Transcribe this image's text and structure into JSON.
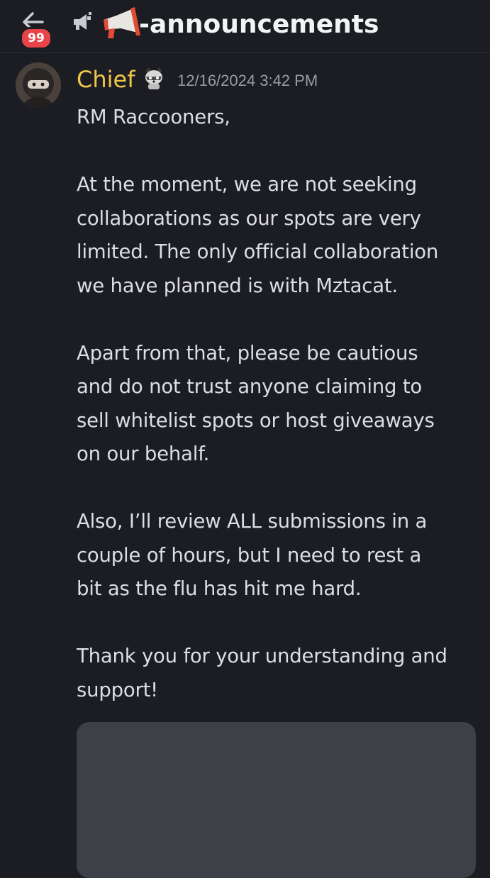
{
  "header": {
    "back_icon": "arrow-left-icon",
    "unread_badge": "99",
    "channel_type_icon": "announcement-channel-icon",
    "channel_emoji": "📣",
    "channel_name": "-announcements"
  },
  "message": {
    "author": "Chief",
    "role_icon": "raccoon-icon",
    "timestamp": "12/16/2024 3:42 PM",
    "paragraphs": [
      [
        "RM Raccooners,"
      ],
      [
        "At the moment, we are not seeking",
        "collaborations as our spots are very",
        "limited. The only official collaboration",
        "we have planned is with Mztacat."
      ],
      [
        "Apart from that, please be cautious",
        "and do not trust anyone claiming to",
        "sell whitelist spots or host giveaways",
        "on our behalf."
      ],
      [
        "Also, I’ll review ALL submissions in a",
        "couple of hours, but I need to rest a",
        "bit as the flu has hit me hard."
      ],
      [
        "Thank you for your understanding and",
        "support!"
      ]
    ]
  },
  "colors": {
    "background": "#1c1d22",
    "author": "#f0c64a",
    "badge": "#e9434a",
    "text": "#dcdee3",
    "timestamp": "#9a9ca3",
    "embed": "#3d4047"
  }
}
